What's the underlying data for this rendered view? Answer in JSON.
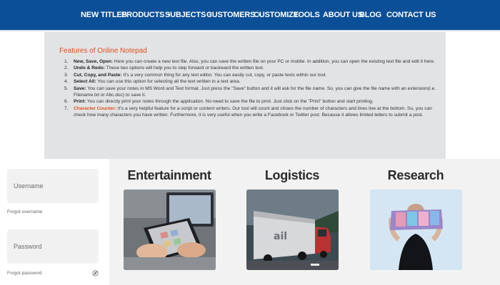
{
  "nav": {
    "items": [
      {
        "label": "NEW TITLES",
        "dropdown": false
      },
      {
        "label": "PRODUCTS",
        "dropdown": true
      },
      {
        "label": "SUBJECTS",
        "dropdown": true
      },
      {
        "label": "CUSTOMERS",
        "dropdown": true
      },
      {
        "label": "CUSTOMIZE",
        "dropdown": false
      },
      {
        "label": "TOOLS",
        "dropdown": false
      },
      {
        "label": "ABOUT US",
        "dropdown": false
      },
      {
        "label": "BLOG",
        "dropdown": false
      },
      {
        "label": "CONTACT US",
        "dropdown": false
      }
    ],
    "dropdown_icon": "chevron-down-icon"
  },
  "features": {
    "title": "Features of Online Notepad",
    "items": [
      {
        "num": "1.",
        "term": "New, Save, Open:",
        "text": " Here you can create a new text file. Also, you can save the written file on your PC or mobile. In addition, you can open the existing text file and edit it here."
      },
      {
        "num": "2.",
        "term": "Undo & Redo:",
        "text": " These two options will help you to step forward or backward the written text."
      },
      {
        "num": "3.",
        "term": "Cut, Copy, and Paste:",
        "text": " It's a very common thing for any text editor. You can easily cut, copy, or paste texts within our tool."
      },
      {
        "num": "4.",
        "term": "Select All:",
        "text": " You can use this option for selecting all the text written in a text area."
      },
      {
        "num": "5.",
        "term": "Save:",
        "text": " You can save your notes in MS Word and Text format. Just press the \"Save\" button and it will ask for the file name. So, you can give the file name with an extension(i.e. Filename.txt or Abc.doc) to save it."
      },
      {
        "num": "6.",
        "term": "Print:",
        "text": " You can directly print your notes through the application. No need to save the file to print. Just click on the \"Print\" button and start printing."
      },
      {
        "num": "7.",
        "term": "Character Counter:",
        "text": " It's a very helpful feature for a script or content writers. Our tool will count and shows the number of characters and lines live at the bottom. So, you can check how many characters you have written. Furthermore, it is very useful when you write a Facebook or Twitter post. Because it allows limited letters to submit a post.",
        "term_color": "#e0501e"
      }
    ]
  },
  "login": {
    "username_placeholder": "Username",
    "forgot_username": "Forgot username",
    "password_placeholder": "Password",
    "forgot_password": "Forgot password",
    "password_toggle_icon": "eye-icon"
  },
  "categories": [
    {
      "title": "Entertainment",
      "image": "tablet-hands-image"
    },
    {
      "title": "Logistics",
      "image": "truck-image"
    },
    {
      "title": "Research",
      "image": "woman-with-paper-image"
    }
  ],
  "colors": {
    "nav_bg": "#0b4f97",
    "accent": "#e0501e",
    "panel_bg": "#e2e3e5"
  }
}
